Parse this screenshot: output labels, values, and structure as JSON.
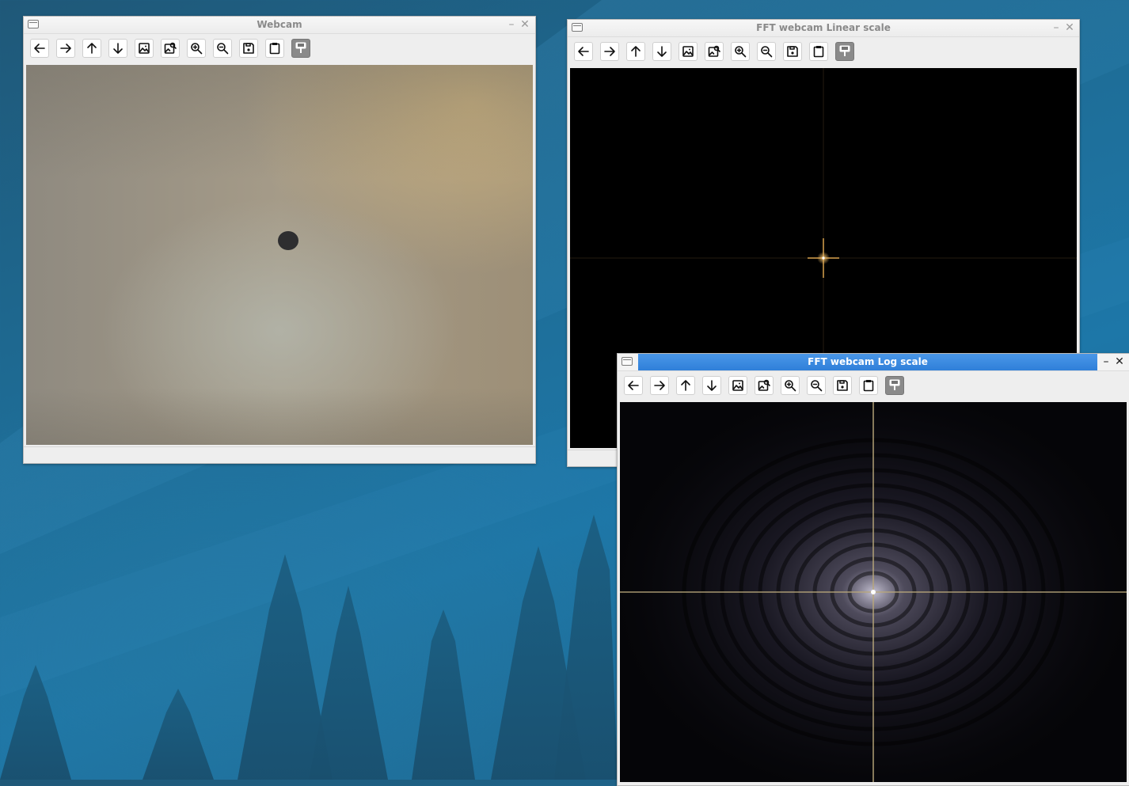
{
  "windows": {
    "webcam": {
      "title": "Webcam"
    },
    "fft_linear": {
      "title": "FFT webcam Linear scale"
    },
    "fft_log": {
      "title": "FFT webcam Log scale"
    }
  },
  "title_buttons": {
    "minimize": "–",
    "close": "✕"
  },
  "toolbar_icons": [
    "arrow-left-icon",
    "arrow-right-icon",
    "arrow-up-icon",
    "arrow-down-icon",
    "image-icon",
    "image-search-icon",
    "zoom-in-icon",
    "zoom-out-icon",
    "save-icon",
    "clipboard-icon",
    "properties-icon"
  ],
  "colors": {
    "desktop": "#1d77a8",
    "window_bg": "#eeeeee",
    "active_title": "#2f7fd9",
    "inactive_title_text": "#8a8a8a"
  }
}
